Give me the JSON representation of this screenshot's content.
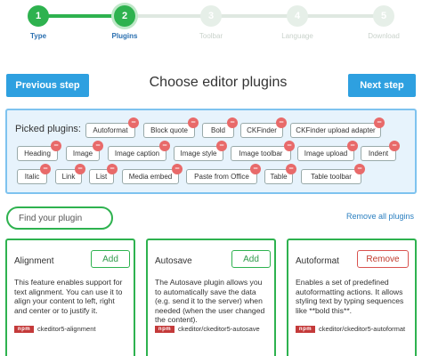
{
  "stepper": {
    "steps": [
      {
        "number": "1",
        "label": "Type",
        "state": "done"
      },
      {
        "number": "2",
        "label": "Plugins",
        "state": "current"
      },
      {
        "number": "3",
        "label": "Toolbar",
        "state": "todo"
      },
      {
        "number": "4",
        "label": "Language",
        "state": "todo"
      },
      {
        "number": "5",
        "label": "Download",
        "state": "todo"
      }
    ]
  },
  "header": {
    "prev_label": "Previous step",
    "title": "Choose editor plugins",
    "next_label": "Next step"
  },
  "picked": {
    "label": "Picked plugins:",
    "remove_glyph": "−",
    "plugins": [
      "Autoformat",
      "Block quote",
      "Bold",
      "CKFinder",
      "CKFinder upload adapter",
      "Heading",
      "Image",
      "Image caption",
      "Image style",
      "Image toolbar",
      "Image upload",
      "Indent",
      "Italic",
      "Link",
      "List",
      "Media embed",
      "Paste from Office",
      "Table",
      "Table toolbar"
    ]
  },
  "search": {
    "placeholder": "Find your plugin",
    "remove_all_label": "Remove all plugins"
  },
  "cards": [
    {
      "title": "Alignment",
      "action": "Add",
      "description": "This feature enables support for text alignment. You can use it to align your content to left, right and center or to justify it.",
      "npm_label": "npm",
      "package": "ckeditor5-alignment"
    },
    {
      "title": "Autosave",
      "action": "Add",
      "description": "The Autosave plugin allows you to automatically save the data (e.g. send it to the server) when needed (when the user changed the content).",
      "npm_label": "npm",
      "package": "ckeditor/ckeditor5-autosave"
    },
    {
      "title": "Autoformat",
      "action": "Remove",
      "description": "Enables a set of predefined autoformatting actions. It allows styling text by typing sequences like **bold this**.",
      "npm_label": "npm",
      "package": "ckeditor/ckeditor5-autoformat"
    }
  ]
}
